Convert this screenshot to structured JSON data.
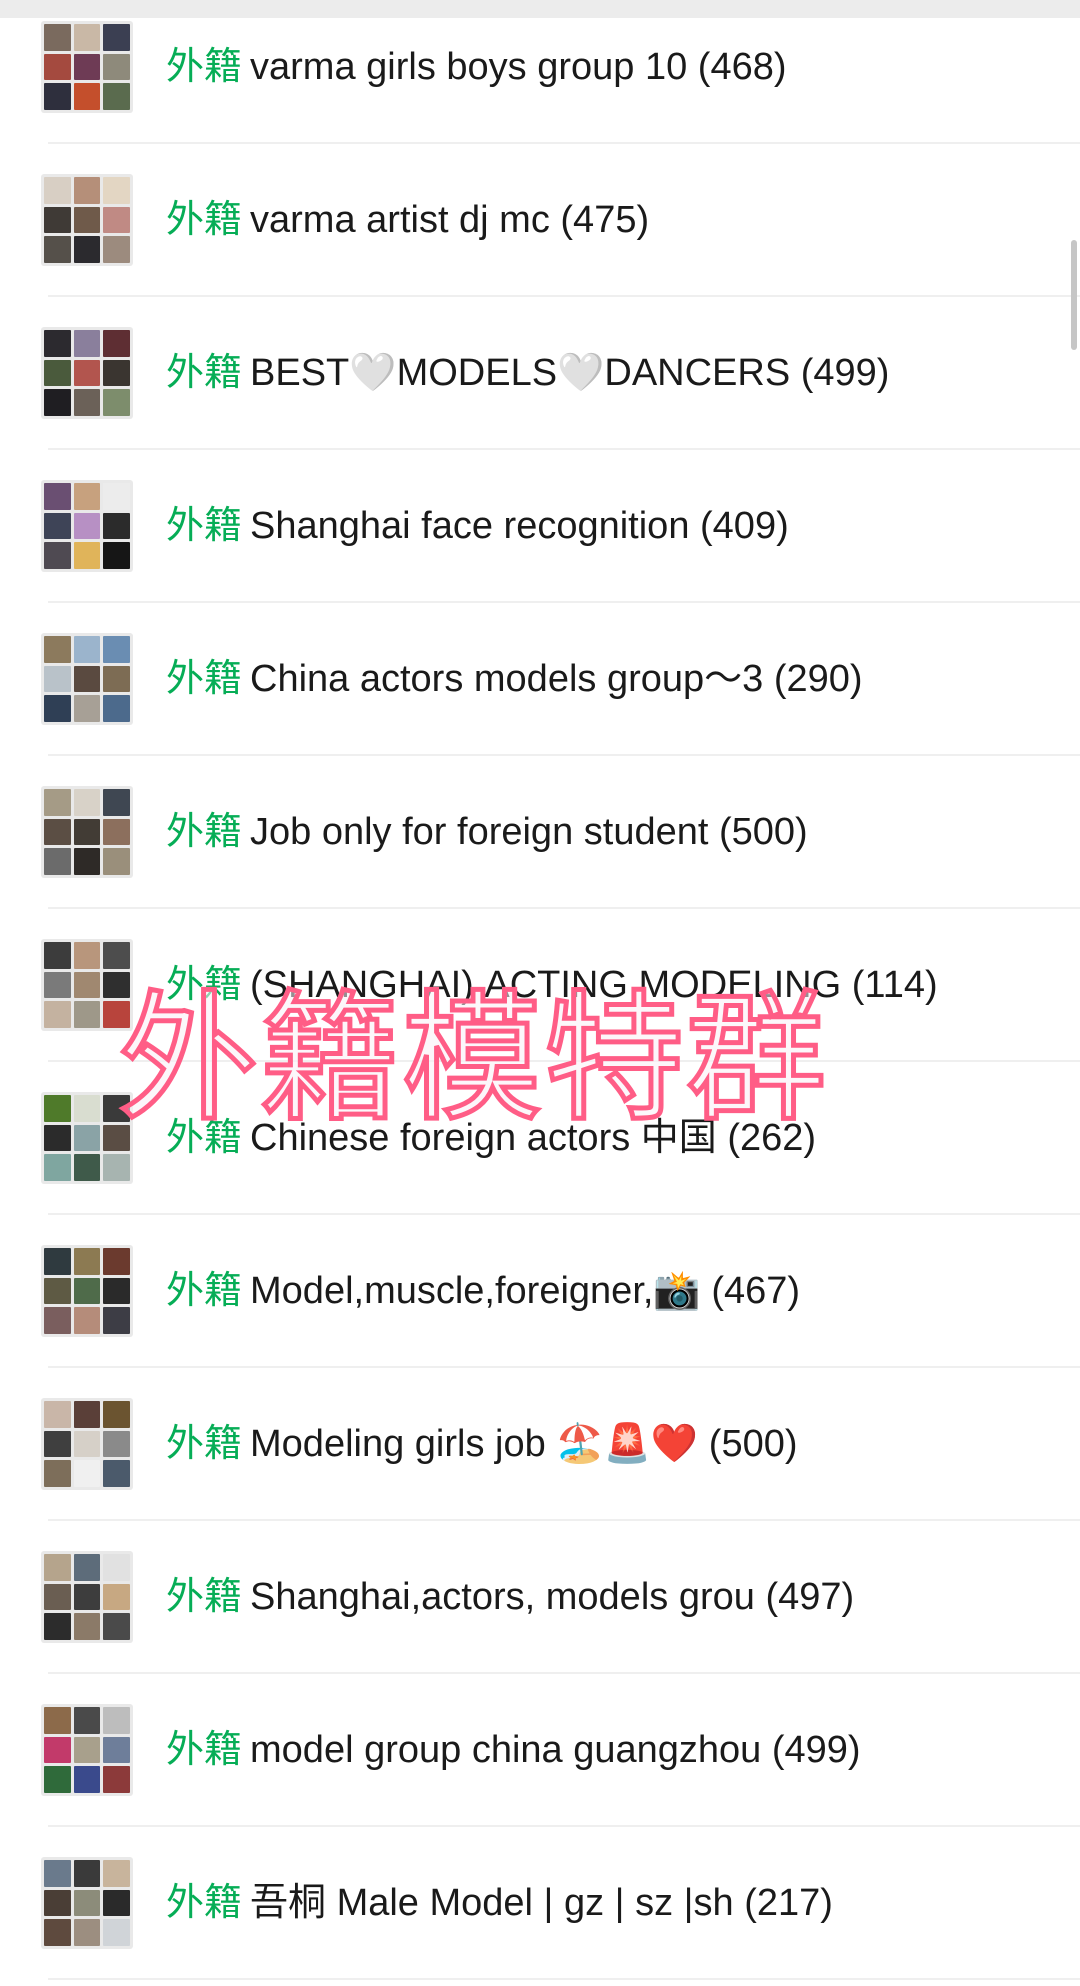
{
  "list": {
    "tag": "外籍",
    "groups": [
      {
        "name": "varma  girls boys group 10",
        "count": "(468)"
      },
      {
        "name": "varma artist dj mc",
        "count": "(475)"
      },
      {
        "name": "BEST🤍MODELS🤍DANCERS",
        "count": "(499)"
      },
      {
        "name": "Shanghai face recognition",
        "count": "(409)"
      },
      {
        "name": "China actors models group～3",
        "count": "(290)"
      },
      {
        "name": "Job only for foreign student",
        "count": "(500)"
      },
      {
        "name": "(SHANGHAI) ACTING MODELING",
        "count": "(114)"
      },
      {
        "name": "Chinese foreign actors 中国",
        "count": "(262)"
      },
      {
        "name": "Model,muscle,foreigner,📸",
        "count": "(467)"
      },
      {
        "name": "Modeling girls job 🏖️🚨❤️",
        "count": "(500)"
      },
      {
        "name": "Shanghai,actors, models grou",
        "count": "(497)"
      },
      {
        "name": "model group china  guangzhou",
        "count": "(499)"
      },
      {
        "name": "吾桐 Male Model | gz | sz |sh",
        "count": "(217)"
      }
    ]
  },
  "overlay": {
    "caption": "外籍模特群",
    "color": "#ff5d86"
  },
  "colors": {
    "tag": "#06ad56",
    "text": "#1a1a1a",
    "divider": "#efefef"
  }
}
